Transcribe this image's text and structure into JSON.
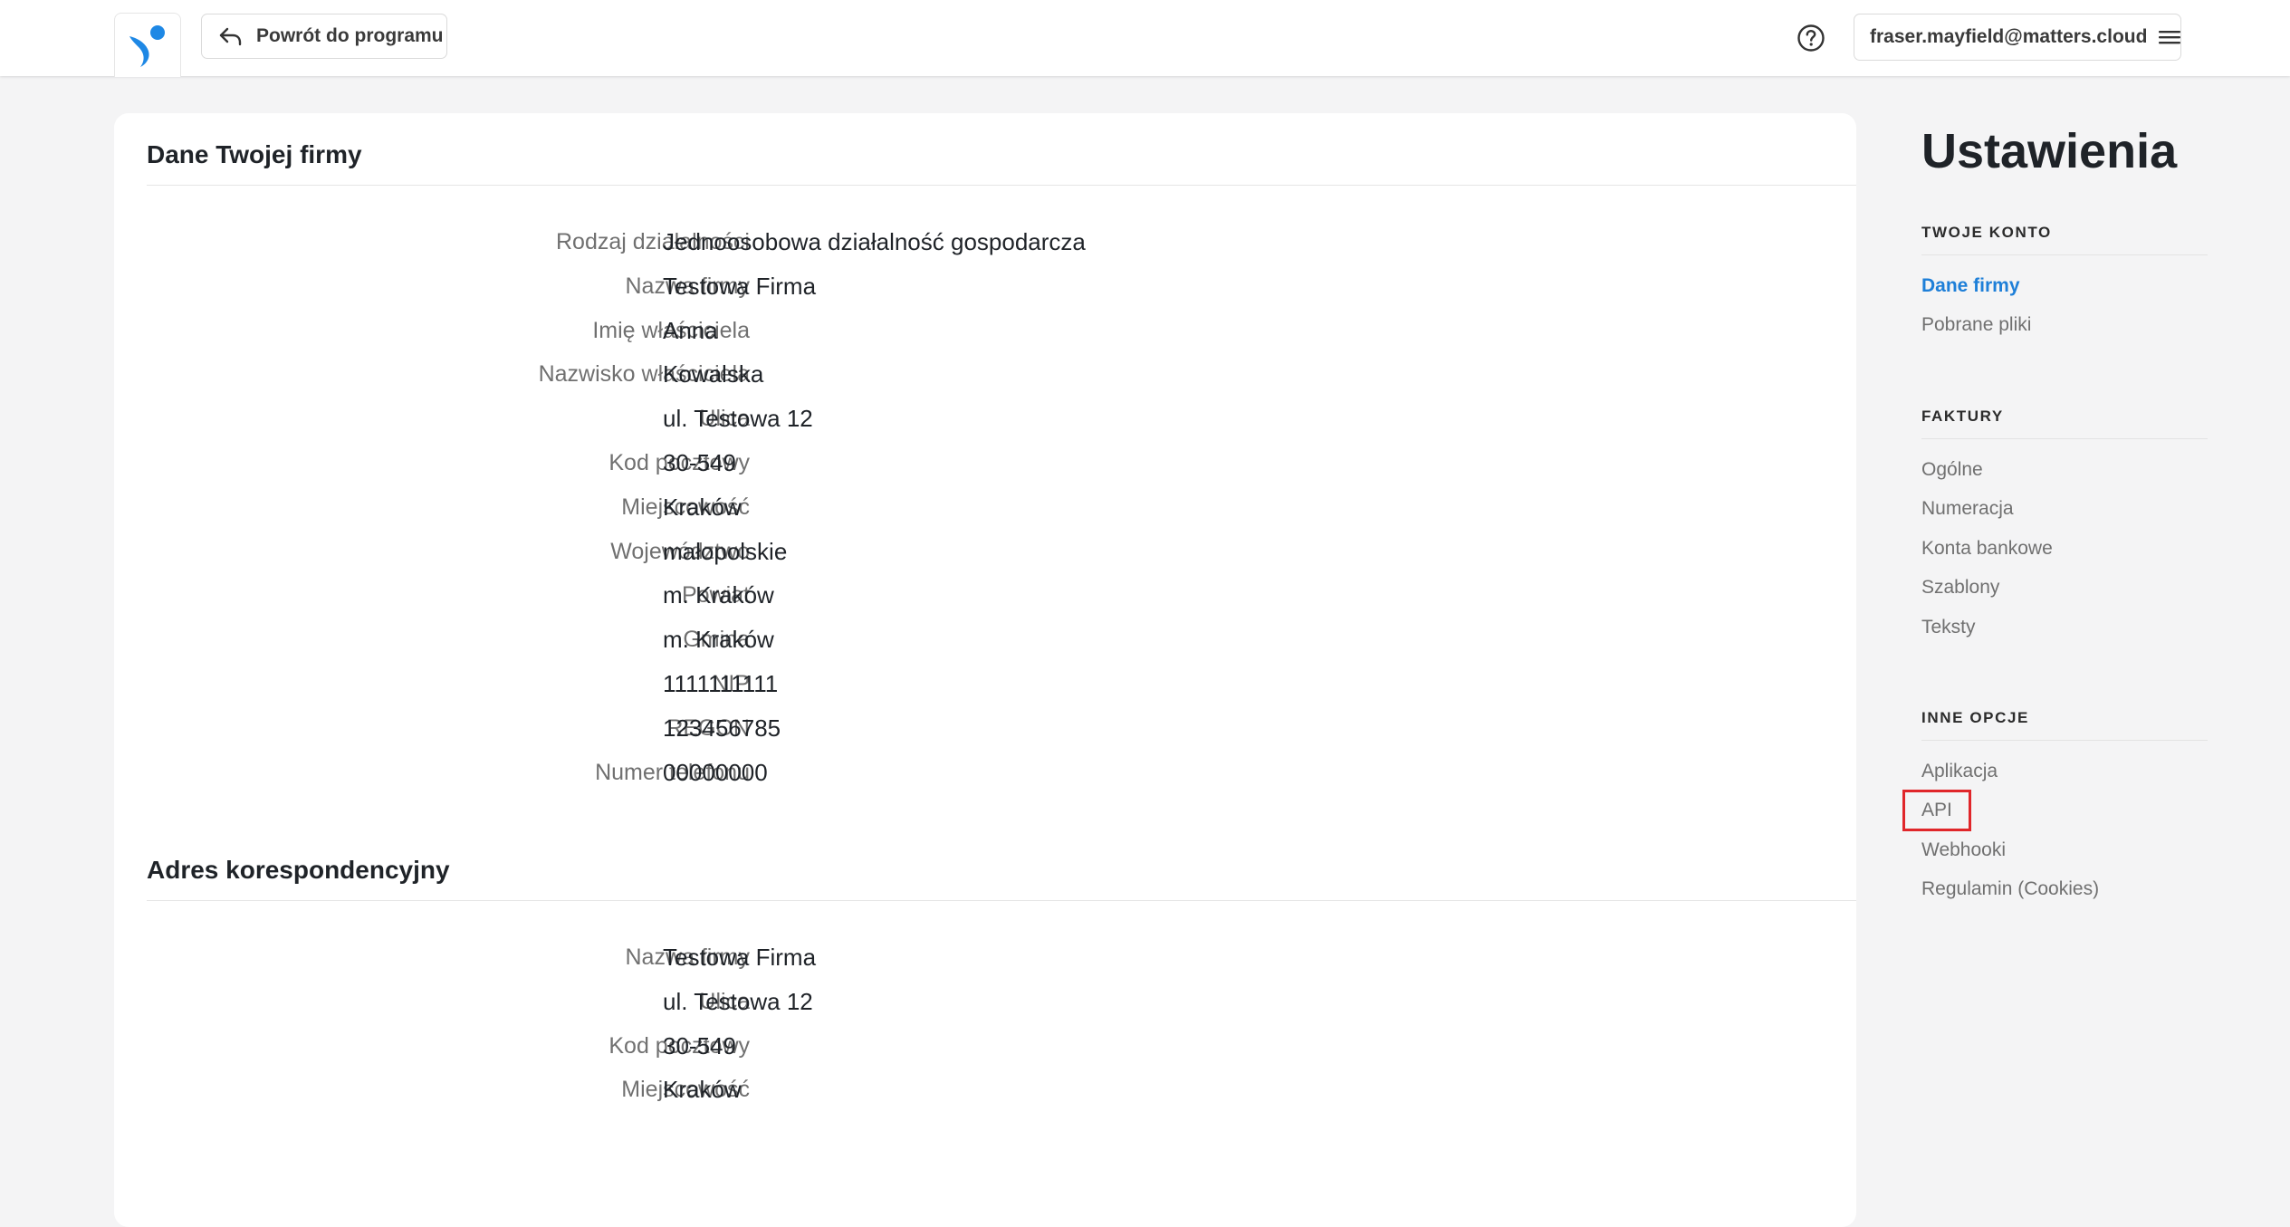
{
  "header": {
    "back_label": "Powrót do programu",
    "account_email": "fraser.mayfield@matters.cloud",
    "brand_color": "#1e88e5"
  },
  "company": {
    "section_title": "Dane Twojej firmy",
    "fields": [
      {
        "label": "Rodzaj działalności",
        "value": "Jednoosobowa działalność gospodarcza"
      },
      {
        "label": "Nazwa firmy",
        "value": "Testowa Firma"
      },
      {
        "label": "Imię właściciela",
        "value": "Anna"
      },
      {
        "label": "Nazwisko właściciela",
        "value": "Kowalska"
      },
      {
        "label": "Ulica",
        "value": "ul. Testowa 12"
      },
      {
        "label": "Kod pocztowy",
        "value": "30-549"
      },
      {
        "label": "Miejscowość",
        "value": "Kraków"
      },
      {
        "label": "Województwo",
        "value": "małopolskie"
      },
      {
        "label": "Powiat",
        "value": "m. Kraków"
      },
      {
        "label": "Gmina",
        "value": "m. Kraków"
      },
      {
        "label": "NIP",
        "value": "1111111111"
      },
      {
        "label": "REGON",
        "value": "123456785"
      },
      {
        "label": "Numer telefonu",
        "value": "00000000"
      }
    ]
  },
  "correspondence": {
    "section_title": "Adres korespondencyjny",
    "fields": [
      {
        "label": "Nazwa firmy",
        "value": "Testowa Firma"
      },
      {
        "label": "Ulica",
        "value": "ul. Testowa 12"
      },
      {
        "label": "Kod pocztowy",
        "value": "30-549"
      },
      {
        "label": "Miejscowość",
        "value": "Kraków"
      }
    ]
  },
  "sidebar": {
    "title": "Ustawienia",
    "groups": [
      {
        "heading": "TWOJE KONTO",
        "items": [
          {
            "label": "Dane firmy",
            "active": true
          },
          {
            "label": "Pobrane pliki"
          }
        ]
      },
      {
        "heading": "FAKTURY",
        "items": [
          {
            "label": "Ogólne"
          },
          {
            "label": "Numeracja"
          },
          {
            "label": "Konta bankowe"
          },
          {
            "label": "Szablony"
          },
          {
            "label": "Teksty"
          }
        ]
      },
      {
        "heading": "INNE OPCJE",
        "items": [
          {
            "label": "Aplikacja"
          },
          {
            "label": "API",
            "highlighted": true
          },
          {
            "label": "Webhooki"
          },
          {
            "label": "Regulamin (Cookies)"
          }
        ]
      }
    ],
    "active_color": "#1e7fd8",
    "highlight_color": "#e0262a"
  }
}
